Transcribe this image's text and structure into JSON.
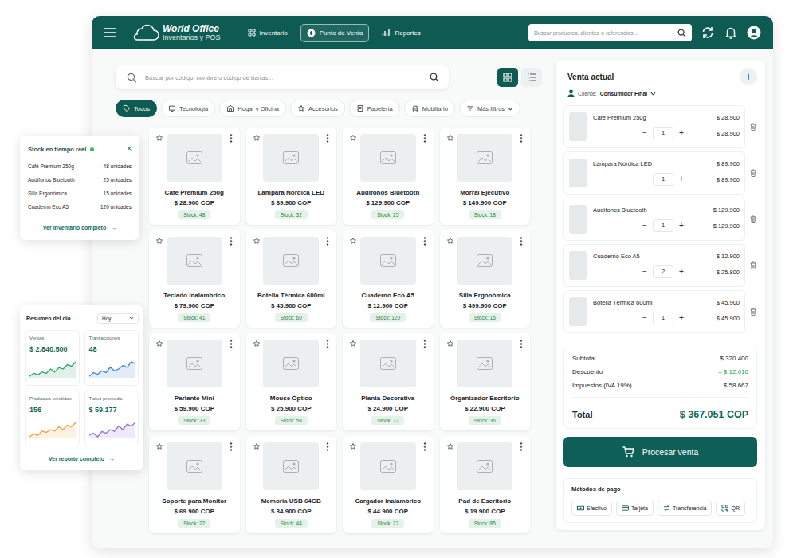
{
  "header": {
    "logo": {
      "title": "World Office",
      "subtitle": "Inventarios y POS"
    },
    "nav": [
      {
        "label": "Inventario",
        "selected": false
      },
      {
        "label": "Punto de Venta",
        "selected": true
      },
      {
        "label": "Reportes",
        "selected": false
      }
    ],
    "search": {
      "placeholder": "Buscar productos, clientes o referencias..."
    }
  },
  "catalog": {
    "search": {
      "placeholder": "Buscar por código, nombre o código de barras..."
    },
    "view_modes": [
      {
        "kind": "grid",
        "selected": true
      },
      {
        "kind": "list",
        "selected": false
      }
    ],
    "filters": [
      {
        "label": "Todos",
        "selected": true,
        "kind": "category"
      },
      {
        "label": "Tecnología",
        "selected": false,
        "kind": "category"
      },
      {
        "label": "Hogar y Oficina",
        "selected": false,
        "kind": "category"
      },
      {
        "label": "Accesorios",
        "selected": false,
        "kind": "category"
      },
      {
        "label": "Papelería",
        "selected": false,
        "kind": "category"
      },
      {
        "label": "Mobiliario",
        "selected": false,
        "kind": "category"
      },
      {
        "label": "Más filtros",
        "selected": false,
        "kind": "dropdown"
      }
    ],
    "products": [
      {
        "name": "Café Premium 250g",
        "price": "$ 28.900 COP",
        "stock": "Stock: 48",
        "favorite": false
      },
      {
        "name": "Lámpara Nórdica LED",
        "price": "$ 89.900 COP",
        "stock": "Stock: 32",
        "favorite": false
      },
      {
        "name": "Audífonos Bluetooth",
        "price": "$ 129.900 COP",
        "stock": "Stock: 25",
        "favorite": false
      },
      {
        "name": "Morral Ejecutivo",
        "price": "$ 149.900 COP",
        "stock": "Stock: 18",
        "favorite": false
      },
      {
        "name": "Teclado Inalámbrico",
        "price": "$ 79.900 COP",
        "stock": "Stock: 41",
        "favorite": false
      },
      {
        "name": "Botella Térmica 600ml",
        "price": "$ 45.900 COP",
        "stock": "Stock: 60",
        "favorite": false
      },
      {
        "name": "Cuaderno Eco A5",
        "price": "$ 12.900 COP",
        "stock": "Stock: 120",
        "favorite": false
      },
      {
        "name": "Silla Ergonómica",
        "price": "$ 499.900 COP",
        "stock": "Stock: 15",
        "favorite": false
      },
      {
        "name": "Parlante Mini",
        "price": "$ 59.900 COP",
        "stock": "Stock: 33",
        "favorite": false
      },
      {
        "name": "Mouse Óptico",
        "price": "$ 25.900 COP",
        "stock": "Stock: 58",
        "favorite": false
      },
      {
        "name": "Planta Decorativa",
        "price": "$ 24.900 COP",
        "stock": "Stock: 72",
        "favorite": false
      },
      {
        "name": "Organizador Escritorio",
        "price": "$ 22.900 COP",
        "stock": "Stock: 36",
        "favorite": false
      },
      {
        "name": "Soporte para Monitor",
        "price": "$ 69.900 COP",
        "stock": "Stock: 22",
        "favorite": false
      },
      {
        "name": "Memoria USB 64GB",
        "price": "$ 34.900 COP",
        "stock": "Stock: 44",
        "favorite": false
      },
      {
        "name": "Cargador Inalámbrico",
        "price": "$ 44.900 COP",
        "stock": "Stock: 27",
        "favorite": false
      },
      {
        "name": "Pad de Escritorio",
        "price": "$ 19.900 COP",
        "stock": "Stock: 85",
        "favorite": false
      }
    ]
  },
  "stock_panel": {
    "title": "Stock en tiempo real",
    "live": true,
    "close": "×",
    "items": [
      {
        "name": "Café Premium 250g",
        "qty": "48 unidades"
      },
      {
        "name": "Audífonos Bluetooth",
        "qty": "25 unidades"
      },
      {
        "name": "Silla Ergonómica",
        "qty": "15 unidades"
      },
      {
        "name": "Cuaderno Eco A5",
        "qty": "120 unidades"
      }
    ],
    "link": "Ver inventario completo",
    "arrow": "→"
  },
  "day_summary": {
    "title": "Resumen del día",
    "period": "Hoy",
    "metrics": [
      {
        "label": "Ventas",
        "value": "$ 2.840.500",
        "color": "#2ea36a",
        "series": [
          3,
          5,
          4,
          6,
          5,
          8,
          6,
          9,
          8,
          11,
          10,
          13
        ]
      },
      {
        "label": "Transacciones",
        "value": "48",
        "color": "#3b82d6",
        "series": [
          4,
          6,
          5,
          7,
          6,
          9,
          7,
          8,
          10,
          9,
          12,
          11
        ]
      },
      {
        "label": "Productos vendidos",
        "value": "156",
        "color": "#f0a03c",
        "series": [
          2,
          4,
          3,
          6,
          5,
          7,
          6,
          9,
          7,
          10,
          9,
          12
        ]
      },
      {
        "label": "Ticket promedio",
        "value": "$ 59.177",
        "color": "#9b6ad8",
        "series": [
          5,
          6,
          4,
          7,
          6,
          8,
          7,
          10,
          8,
          11,
          10,
          12
        ]
      }
    ],
    "link": "Ver reporte completo",
    "arrow": "→"
  },
  "sale": {
    "title": "Venta actual",
    "add": "+",
    "client_label": "Cliente:",
    "client": "Consumidor Final",
    "minus": "−",
    "plus": "+",
    "items": [
      {
        "name": "Café Premium 250g",
        "unit_price": "$ 28.900",
        "qty": "1",
        "line_total": "$ 28.900"
      },
      {
        "name": "Lámpara Nórdica LED",
        "unit_price": "$ 89.900",
        "qty": "1",
        "line_total": "$ 89.900"
      },
      {
        "name": "Audífonos Bluetooth",
        "unit_price": "$ 129.900",
        "qty": "1",
        "line_total": "$ 129.900"
      },
      {
        "name": "Cuaderno Eco A5",
        "unit_price": "$ 12.900",
        "qty": "2",
        "line_total": "$ 25.800"
      },
      {
        "name": "Botella Térmica 600ml",
        "unit_price": "$ 45.900",
        "qty": "1",
        "line_total": "$ 45.900"
      }
    ],
    "totals": [
      {
        "label": "Subtotal",
        "value": "$ 320.400",
        "kind": "normal"
      },
      {
        "label": "Descuento",
        "value": "– $ 12.016",
        "kind": "discount"
      },
      {
        "label": "Impuestos (IVA 19%)",
        "value": "$ 58.667",
        "kind": "normal"
      }
    ],
    "total": {
      "label": "Total",
      "value": "$ 367.051 COP"
    },
    "process_button": "Procesar venta",
    "payment_title": "Métodos de pago",
    "payment_methods": [
      "Efectivo",
      "Tarjeta",
      "Transferencia",
      "QR"
    ]
  }
}
